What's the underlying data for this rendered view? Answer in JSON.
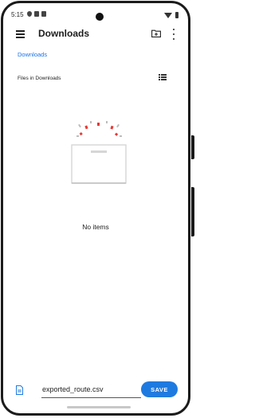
{
  "status_bar": {
    "time": "5:15"
  },
  "app_bar": {
    "title": "Downloads",
    "menu_icon": "menu-icon",
    "new_folder_icon": "new-folder-icon",
    "more_icon": "more-vert-icon"
  },
  "breadcrumb": {
    "current": "Downloads"
  },
  "files_section": {
    "header": "Files in Downloads",
    "view_toggle_icon": "list-view-icon"
  },
  "empty_state": {
    "message": "No items"
  },
  "save_bar": {
    "file_icon": "file-icon",
    "filename_value": "exported_route.csv",
    "save_label": "SAVE"
  },
  "colors": {
    "accent": "#1f7ae0",
    "link": "#1a73e8",
    "frame": "#1b1b1b",
    "illustration_red": "#e53935"
  }
}
